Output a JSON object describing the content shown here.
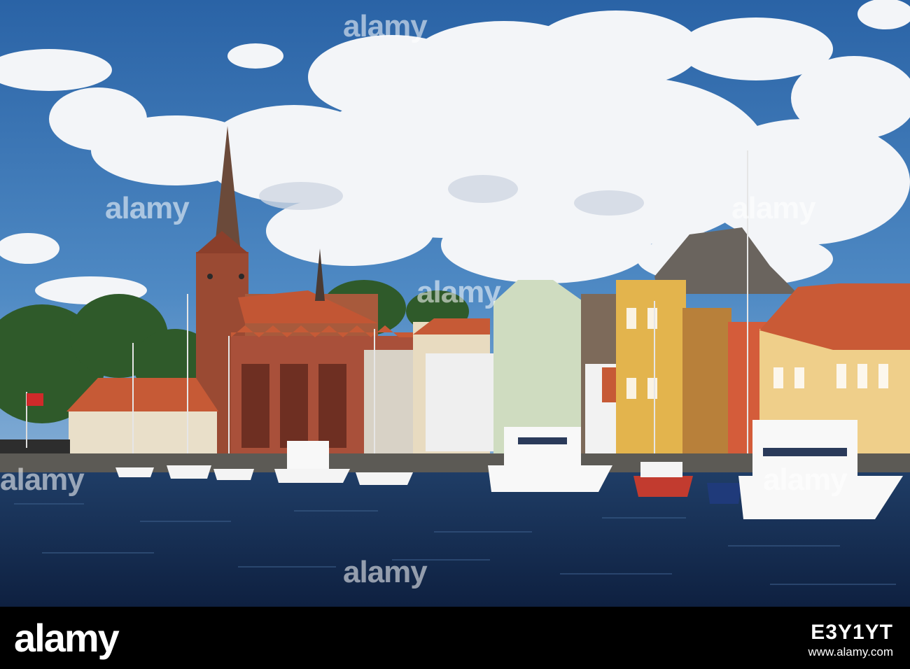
{
  "watermark": {
    "brand": "alamy",
    "text": "alamy"
  },
  "footer": {
    "brand": "alamy",
    "caption": "www.alamy.com",
    "image_id": "E3Y1YT"
  },
  "colors": {
    "sky": "#2f6fb0",
    "cloud": "#f4f6f8",
    "water": "#142a4a",
    "roof_red": "#c5502e",
    "brick": "#8c3a25",
    "yellow_house": "#e3b44d",
    "green_house": "#cfdcc0",
    "footer": "#000000"
  }
}
